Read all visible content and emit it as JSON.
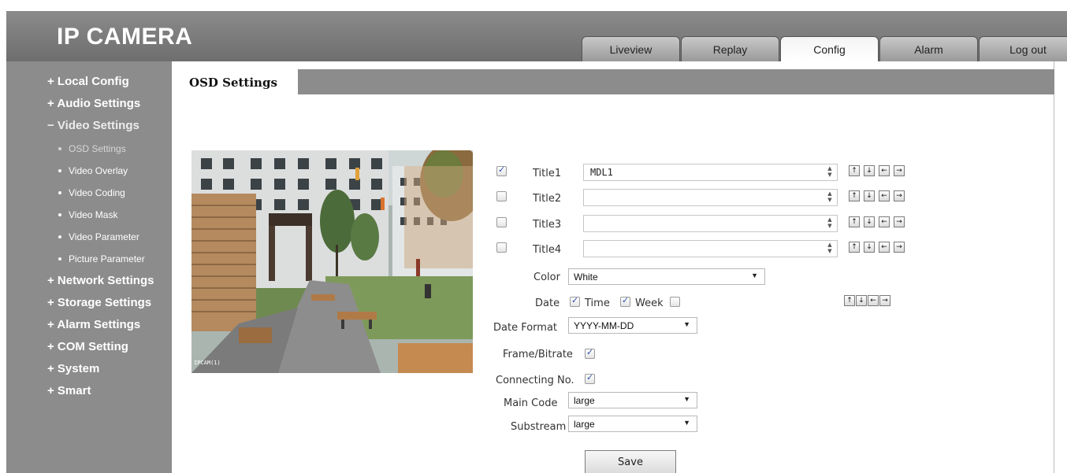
{
  "header": {
    "logo": "IP CAMERA"
  },
  "nav_tabs": [
    {
      "label": "Liveview"
    },
    {
      "label": "Replay"
    },
    {
      "label": "Config",
      "active": true
    },
    {
      "label": "Alarm"
    },
    {
      "label": "Log out"
    }
  ],
  "sidebar": {
    "local_config": "+ Local Config",
    "audio_settings": "+ Audio Settings",
    "video_settings": "− Video Settings",
    "sub": {
      "osd": "OSD Settings",
      "overlay": "Video Overlay",
      "coding": "Video Coding",
      "mask": "Video Mask",
      "parameter": "Video Parameter",
      "picture": "Picture Parameter"
    },
    "network_settings": "+ Network Settings",
    "storage_settings": "+ Storage Settings",
    "alarm_settings": "+ Alarm Settings",
    "com_setting": "+ COM Setting",
    "system": "+ System",
    "smart": "+ Smart"
  },
  "subtab": {
    "label": "OSD Settings"
  },
  "preview": {
    "overlay_text": "IPCAM(1)"
  },
  "form": {
    "titles": [
      {
        "label": "Title1",
        "value": "MDL1",
        "checked": true
      },
      {
        "label": "Title2",
        "value": "",
        "checked": false
      },
      {
        "label": "Title3",
        "value": "",
        "checked": false
      },
      {
        "label": "Title4",
        "value": "",
        "checked": false
      }
    ],
    "color_label": "Color",
    "color_value": "White",
    "date_label": "Date",
    "time_label": "Time",
    "week_label": "Week",
    "date_format_label": "Date Format",
    "date_format_value": "YYYY-MM-DD",
    "frame_bitrate_label": "Frame/Bitrate",
    "connecting_label": "Connecting No.",
    "main_code_label": "Main Code",
    "main_code_value": "large",
    "substream_label": "Substream",
    "substream_value": "large",
    "save_label": "Save"
  },
  "icons": {
    "up": "arrow-up-icon",
    "down": "arrow-down-icon",
    "left": "arrow-left-icon",
    "right": "arrow-right-icon"
  },
  "colors": {
    "header": "#7c7c7c",
    "sidebar": "#8c8c8c",
    "checkmark": "#2d50a5"
  }
}
